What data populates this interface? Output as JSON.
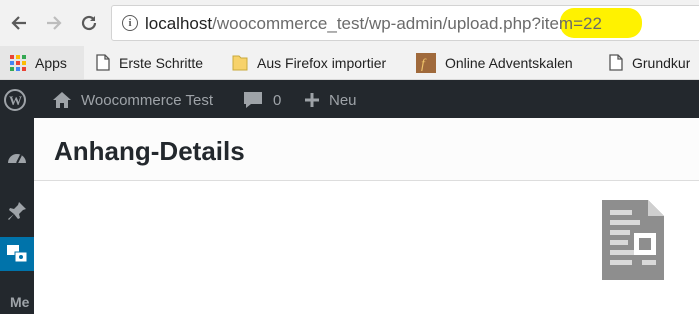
{
  "browser": {
    "url_host": "localhost",
    "url_path": "/woocommerce_test/wp-admin/upload.php?",
    "url_query": "item=22",
    "icons": {
      "back": "back-arrow-icon",
      "forward": "forward-arrow-icon",
      "reload": "reload-icon",
      "info": "info-icon"
    },
    "highlight_color": "#fff200"
  },
  "bookmarks": {
    "apps": "Apps",
    "items": [
      {
        "label": "Erste Schritte",
        "icon": "page-icon"
      },
      {
        "label": "Aus Firefox importier",
        "icon": "folder-icon"
      },
      {
        "label": "Online Adventskalen",
        "icon": "favicon"
      },
      {
        "label": "Grundkur",
        "icon": "page-icon"
      }
    ]
  },
  "adminbar": {
    "site_name": "Woocommerce Test",
    "comments_count": "0",
    "new_label": "Neu",
    "bg_color": "#23282d"
  },
  "sidemenu": {
    "partial_label": "Me",
    "active_color": "#0073aa"
  },
  "modal": {
    "title": "Anhang-Details"
  }
}
